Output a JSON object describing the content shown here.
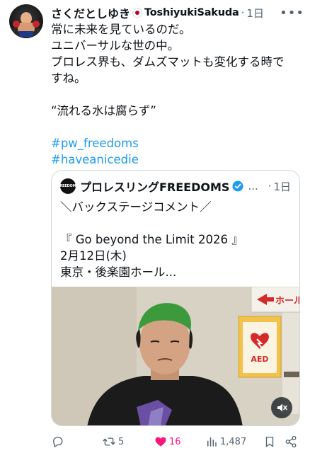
{
  "post": {
    "author_name": "さくだとしゆき",
    "handle": "ToshiyukiSakuda",
    "separator": "·",
    "time": "1日",
    "more_label": "•••",
    "lines": [
      "常に未来を見ているのだ。",
      "ユニバーサルな世の中。",
      "プロレス界も、ダムズマットも変化する時で",
      "すね。",
      "",
      "“流れる水は腐らず”",
      ""
    ],
    "hashtags": [
      "#pw_freedoms",
      "#haveanicedie"
    ]
  },
  "quoted": {
    "avatar_text": "FREEDOMS",
    "name": "プロレスリングFREEDOMS",
    "ellipsis": "...",
    "separator": "·",
    "time": "1日",
    "lines": [
      "＼バックステージコメント／",
      "",
      "『 Go beyond the Limit 2026 』",
      "2月12日(木)",
      "東京・後楽園ホール..."
    ],
    "video": {
      "sign_text": "ホール",
      "aed_label": "AED",
      "mute_icon": "speaker-muted-icon"
    }
  },
  "actions": {
    "replies": "",
    "reposts": "5",
    "likes": "16",
    "views": "1,487"
  },
  "colors": {
    "link": "#1d9bf0",
    "like": "#f91880",
    "muted": "#536471",
    "verified": "#1d9bf0"
  }
}
